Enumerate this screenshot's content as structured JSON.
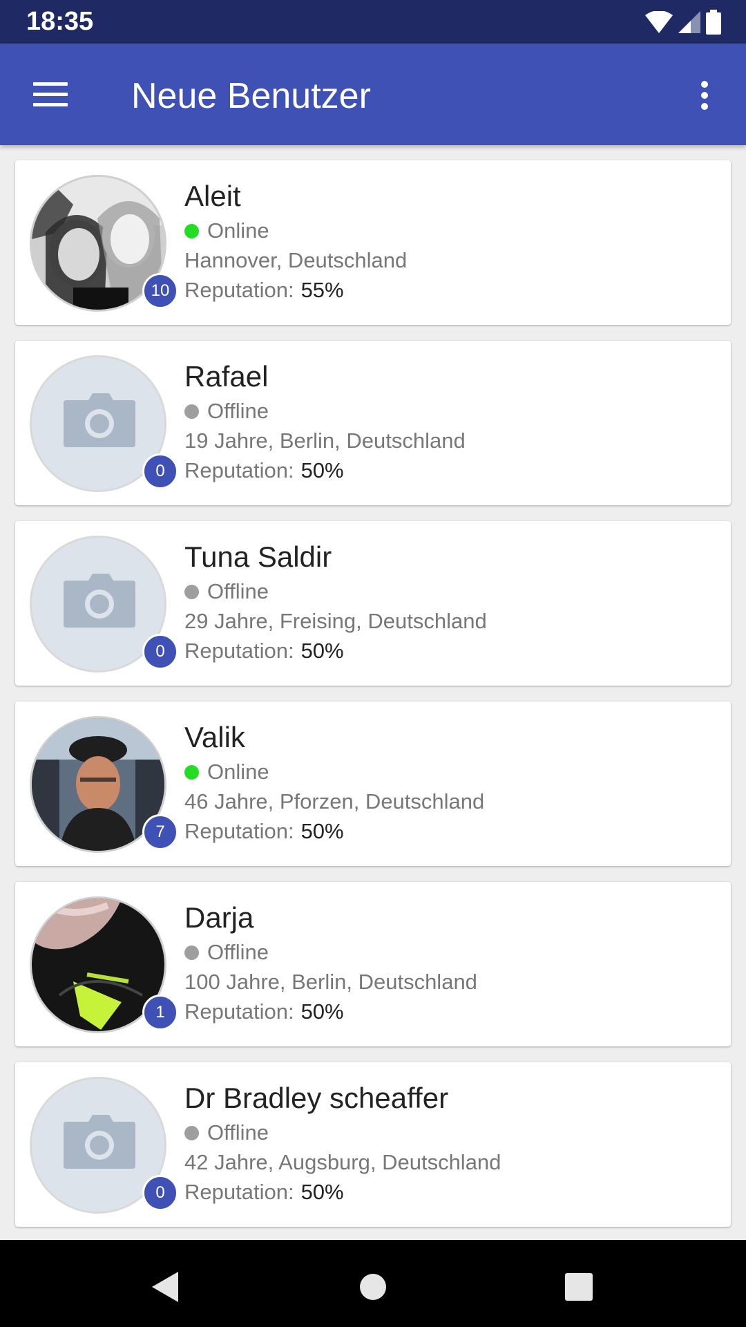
{
  "status_bar": {
    "time": "18:35"
  },
  "app_bar": {
    "title": "Neue Benutzer"
  },
  "colors": {
    "primary": "#3f51b5",
    "online": "#22dd22",
    "offline": "#9e9e9e"
  },
  "users": [
    {
      "name": "Aleit",
      "status": "Online",
      "online": true,
      "location": "Hannover, Deutschland",
      "reputation_label": "Reputation:",
      "reputation": "55%",
      "badge": "10",
      "avatar": "photo-girls"
    },
    {
      "name": "Rafael",
      "status": "Offline",
      "online": false,
      "location": "19 Jahre, Berlin, Deutschland",
      "reputation_label": "Reputation:",
      "reputation": "50%",
      "badge": "0",
      "avatar": "camera-placeholder"
    },
    {
      "name": "Tuna Saldir",
      "status": "Offline",
      "online": false,
      "location": "29 Jahre, Freising, Deutschland",
      "reputation_label": "Reputation:",
      "reputation": "50%",
      "badge": "0",
      "avatar": "camera-placeholder"
    },
    {
      "name": "Valik",
      "status": "Online",
      "online": true,
      "location": "46 Jahre, Pforzen, Deutschland",
      "reputation_label": "Reputation:",
      "reputation": "50%",
      "badge": "7",
      "avatar": "photo-man"
    },
    {
      "name": "Darja",
      "status": "Offline",
      "online": false,
      "location": "100 Jahre, Berlin, Deutschland",
      "reputation_label": "Reputation:",
      "reputation": "50%",
      "badge": "1",
      "avatar": "photo-dark"
    },
    {
      "name": "Dr Bradley scheaffer",
      "status": "Offline",
      "online": false,
      "location": "42 Jahre, Augsburg, Deutschland",
      "reputation_label": "Reputation:",
      "reputation": "50%",
      "badge": "0",
      "avatar": "camera-placeholder"
    }
  ]
}
